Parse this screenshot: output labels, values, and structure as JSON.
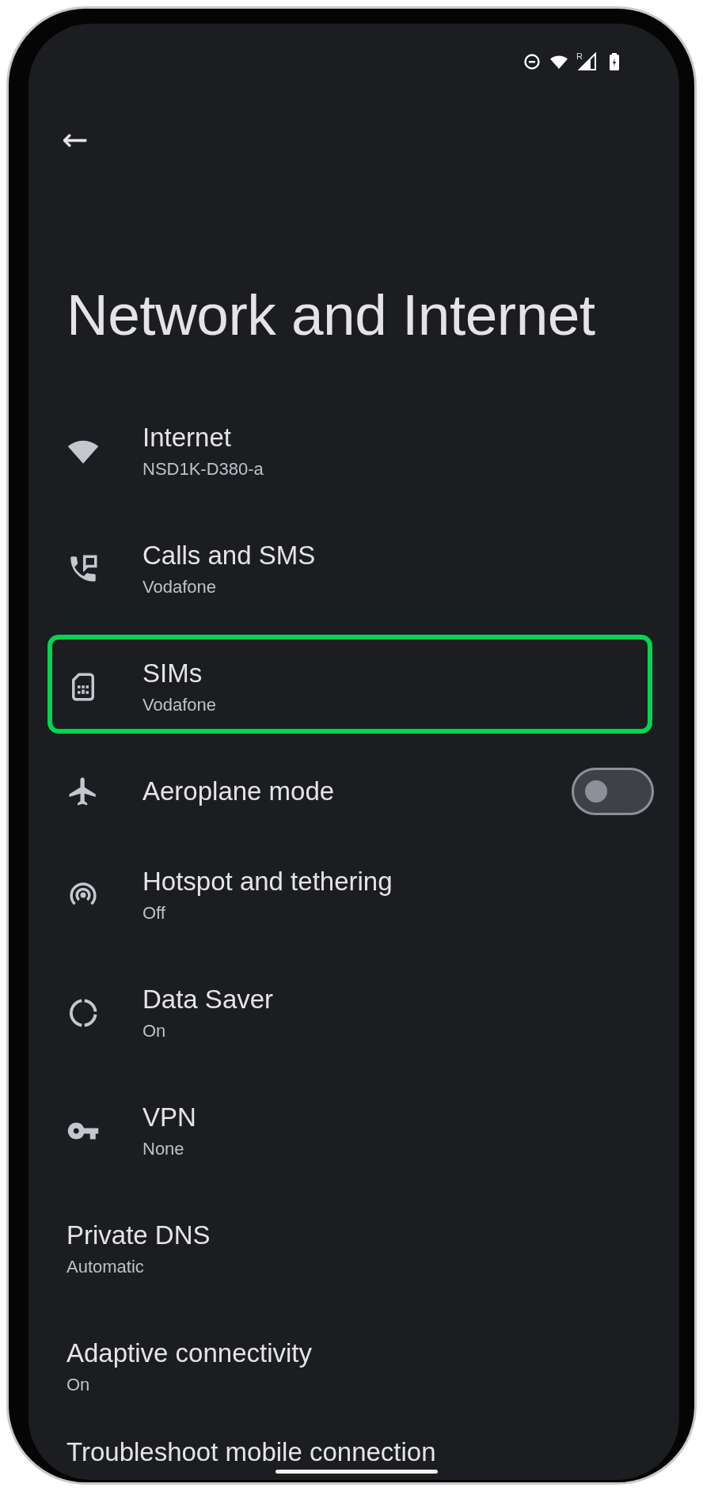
{
  "status_bar": {
    "roaming": "R"
  },
  "back_button": {
    "label": "←"
  },
  "title": "Network and Internet",
  "items": [
    {
      "kind": "link",
      "title": "Internet",
      "subtitle": "NSD1K-D380-a",
      "highlighted": false
    },
    {
      "kind": "link",
      "title": "Calls and SMS",
      "subtitle": "Vodafone",
      "highlighted": false
    },
    {
      "kind": "link",
      "title": "SIMs",
      "subtitle": "Vodafone",
      "highlighted": true
    },
    {
      "kind": "toggle",
      "title": "Aeroplane mode",
      "on": false,
      "highlighted": false
    },
    {
      "kind": "link",
      "title": "Hotspot and tethering",
      "subtitle": "Off",
      "highlighted": false
    },
    {
      "kind": "link",
      "title": "Data Saver",
      "subtitle": "On",
      "highlighted": false
    },
    {
      "kind": "link",
      "title": "VPN",
      "subtitle": "None",
      "highlighted": false
    }
  ],
  "more_items": [
    {
      "title": "Private DNS",
      "subtitle": "Automatic"
    },
    {
      "title": "Adaptive connectivity",
      "subtitle": "On"
    },
    {
      "title": "Troubleshoot mobile connection"
    }
  ]
}
